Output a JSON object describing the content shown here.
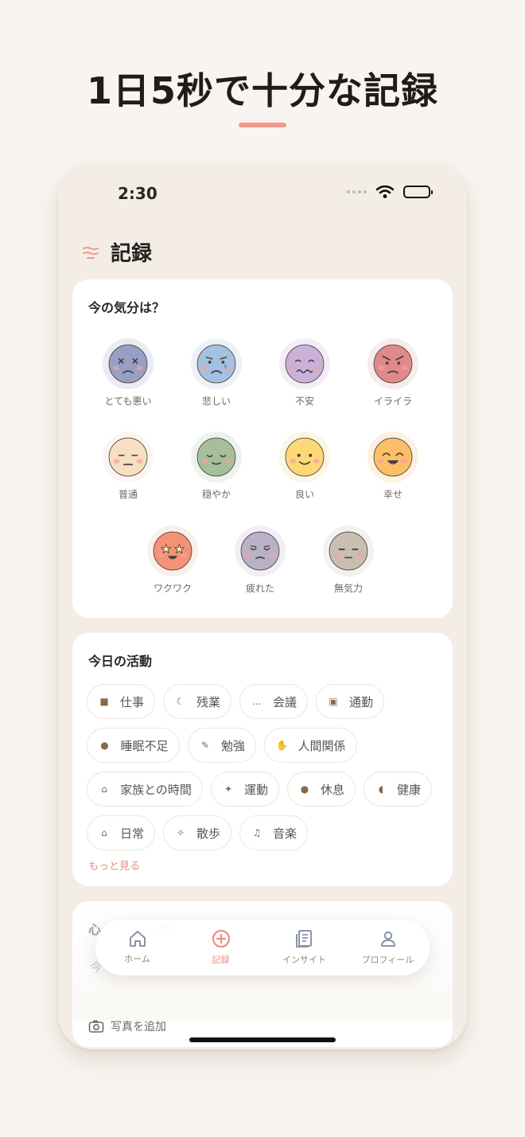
{
  "hero": {
    "title": "1日5秒で十分な記録"
  },
  "status_bar": {
    "time": "2:30"
  },
  "header": {
    "title": "記録",
    "icon": "menu-lines-icon"
  },
  "mood": {
    "title": "今の気分は？",
    "options": [
      {
        "label": "とても悪い",
        "color": "#97a0c4",
        "ring": "#e9ecf3",
        "expr": "x"
      },
      {
        "label": "悲しい",
        "color": "#a5c1e1",
        "ring": "#edf1f6",
        "expr": "sad"
      },
      {
        "label": "不安",
        "color": "#c9b1da",
        "ring": "#f3eef6",
        "expr": "anx"
      },
      {
        "label": "イライラ",
        "color": "#e1898a",
        "ring": "#f7eceb",
        "expr": "angry"
      },
      {
        "label": "普通",
        "color": "#f7dfc4",
        "ring": "#fbf6f1",
        "expr": "neutral"
      },
      {
        "label": "穏やか",
        "color": "#a5bf9a",
        "ring": "#eef2ec",
        "expr": "calm"
      },
      {
        "label": "良い",
        "color": "#fbd878",
        "ring": "#fcf6e6",
        "expr": "smile"
      },
      {
        "label": "幸せ",
        "color": "#fbc067",
        "ring": "#fcf1e2",
        "expr": "happy"
      },
      {
        "label": "ワクワク",
        "color": "#f49278",
        "ring": "#fbefea",
        "expr": "star"
      },
      {
        "label": "疲れた",
        "color": "#b9b1c8",
        "ring": "#f1eff4",
        "expr": "tired"
      },
      {
        "label": "無気力",
        "color": "#c8beb2",
        "ring": "#f4f1ee",
        "expr": "flat"
      }
    ]
  },
  "activities": {
    "title": "今日の活動",
    "chips": [
      {
        "label": "仕事",
        "icon": "briefcase-icon",
        "glyph": "■"
      },
      {
        "label": "残業",
        "icon": "moon-icon",
        "glyph": "☾"
      },
      {
        "label": "会議",
        "icon": "speech-bubble-icon",
        "glyph": "…"
      },
      {
        "label": "通勤",
        "icon": "train-icon",
        "glyph": "▣"
      },
      {
        "label": "睡眠不足",
        "icon": "sleepy-face-icon",
        "glyph": "●"
      },
      {
        "label": "勉強",
        "icon": "memo-icon",
        "glyph": "✎"
      },
      {
        "label": "人間関係",
        "icon": "handshake-icon",
        "glyph": "✋"
      },
      {
        "label": "家族との時間",
        "icon": "house-garden-icon",
        "glyph": "⌂"
      },
      {
        "label": "運動",
        "icon": "runner-icon",
        "glyph": "✦"
      },
      {
        "label": "休息",
        "icon": "relieved-face-icon",
        "glyph": "●"
      },
      {
        "label": "健康",
        "icon": "pill-icon",
        "glyph": "◖"
      },
      {
        "label": "日常",
        "icon": "house-icon",
        "glyph": "⌂"
      },
      {
        "label": "散歩",
        "icon": "walker-icon",
        "glyph": "✧"
      },
      {
        "label": "音楽",
        "icon": "music-note-icon",
        "glyph": "♫"
      }
    ],
    "more": "もっと見る"
  },
  "note": {
    "title_partial": "心",
    "title_partial_2": "一言",
    "hint_partial": "今",
    "photo_label": "写真を追加"
  },
  "tabbar": {
    "tabs": [
      {
        "label": "ホーム",
        "icon": "home-icon"
      },
      {
        "label": "記録",
        "icon": "plus-circle-icon"
      },
      {
        "label": "インサイト",
        "icon": "document-icon"
      },
      {
        "label": "プロフィール",
        "icon": "person-icon"
      }
    ],
    "active": "記録",
    "accent": "#ef8d7b"
  }
}
